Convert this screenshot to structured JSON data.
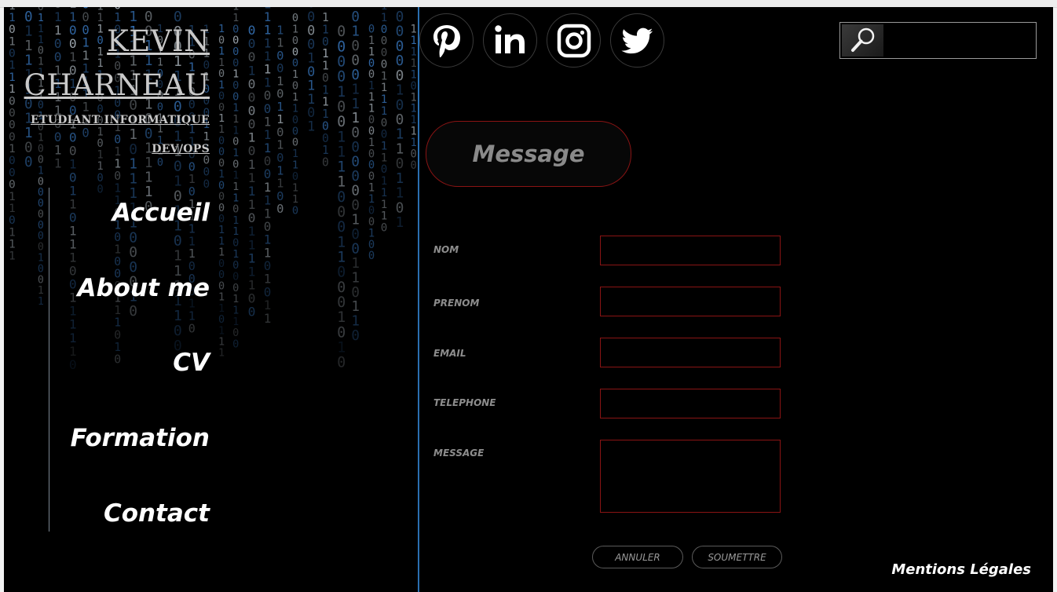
{
  "brand": {
    "first_name": "KEVIN",
    "last_name": "CHARNEAU",
    "subtitle_line1": "ETUDIANT INFORMATIQUE",
    "subtitle_line2": "DEV/OPS"
  },
  "nav": {
    "items": [
      {
        "label": "Accueil"
      },
      {
        "label": "About me"
      },
      {
        "label": "CV"
      },
      {
        "label": "Formation"
      },
      {
        "label": "Contact"
      }
    ]
  },
  "social": {
    "icons": [
      "pinterest-icon",
      "linkedin-icon",
      "instagram-icon",
      "twitter-icon"
    ]
  },
  "search": {
    "placeholder": ""
  },
  "form": {
    "heading": "Message",
    "fields": [
      {
        "label": "NOM",
        "value": ""
      },
      {
        "label": "PRENOM",
        "value": ""
      },
      {
        "label": "EMAIL",
        "value": ""
      },
      {
        "label": "TELEPHONE",
        "value": ""
      },
      {
        "label": "MESSAGE",
        "value": ""
      }
    ],
    "cancel_label": "ANNULER",
    "submit_label": "SOUMETTRE"
  },
  "footer": {
    "legal_label": "Mentions Légales"
  },
  "colors": {
    "background": "#000000",
    "accent_red": "#8a1414",
    "matrix_blue": "#2a6fb0",
    "text_white": "#ffffff",
    "text_grey": "#8d8d8d"
  }
}
